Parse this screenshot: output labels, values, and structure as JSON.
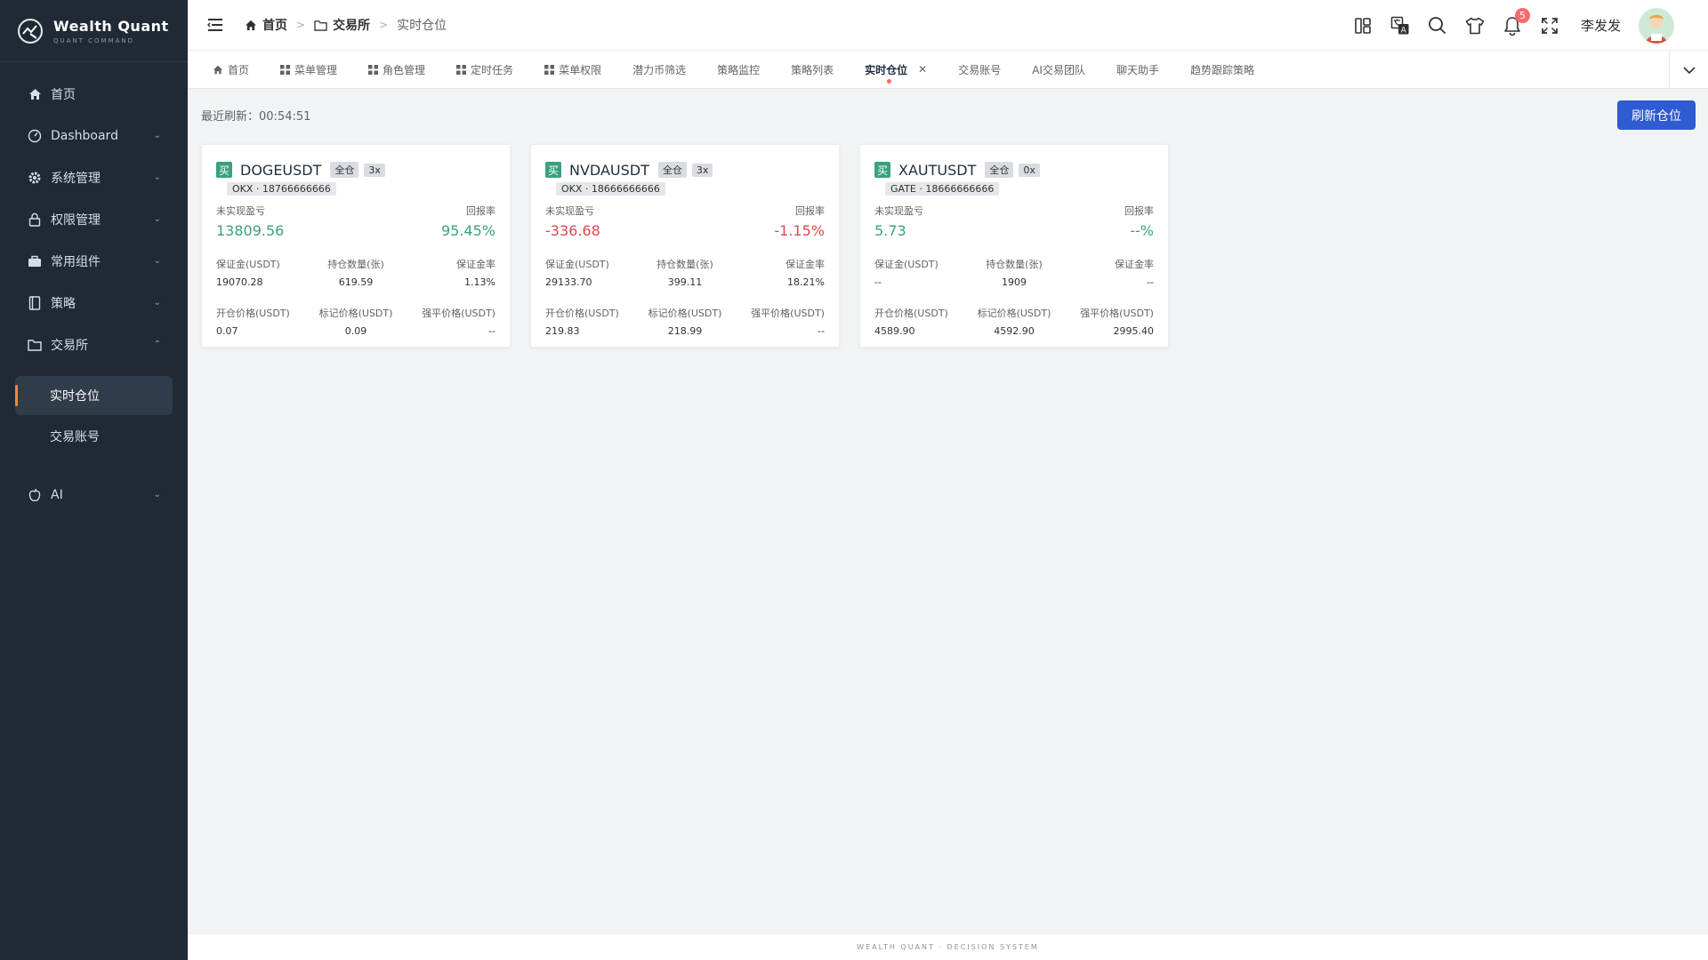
{
  "brand": {
    "name": "Wealth Quant",
    "subtitle": "QUANT COMMAND"
  },
  "sidebar": {
    "items": [
      {
        "label": "首页",
        "icon": "home-icon",
        "expandable": false
      },
      {
        "label": "Dashboard",
        "icon": "dashboard-icon",
        "expandable": true
      },
      {
        "label": "系统管理",
        "icon": "gear-icon",
        "expandable": true
      },
      {
        "label": "权限管理",
        "icon": "lock-icon",
        "expandable": true
      },
      {
        "label": "常用组件",
        "icon": "briefcase-icon",
        "expandable": true
      },
      {
        "label": "策略",
        "icon": "book-icon",
        "expandable": true
      },
      {
        "label": "交易所",
        "icon": "folder-icon",
        "expandable": true,
        "expanded": true
      },
      {
        "label": "AI",
        "icon": "apple-icon",
        "expandable": true
      }
    ],
    "submenu": [
      {
        "label": "实时仓位",
        "active": true
      },
      {
        "label": "交易账号",
        "active": false
      }
    ]
  },
  "header": {
    "breadcrumb": [
      "首页",
      "交易所",
      "实时仓位"
    ],
    "username": "李发发",
    "notification_count": "5"
  },
  "tabs": [
    {
      "label": "首页",
      "icon": "home-icon"
    },
    {
      "label": "菜单管理",
      "icon": "grid-icon"
    },
    {
      "label": "角色管理",
      "icon": "grid-icon"
    },
    {
      "label": "定时任务",
      "icon": "grid-icon"
    },
    {
      "label": "菜单权限",
      "icon": "grid-icon"
    },
    {
      "label": "潜力币筛选"
    },
    {
      "label": "策略监控"
    },
    {
      "label": "策略列表"
    },
    {
      "label": "实时仓位",
      "active": true,
      "closable": true
    },
    {
      "label": "交易账号"
    },
    {
      "label": "AI交易团队"
    },
    {
      "label": "聊天助手"
    },
    {
      "label": "趋势跟踪策略"
    }
  ],
  "main": {
    "last_refresh_label": "最近刷新：",
    "last_refresh_time": "00:54:51",
    "refresh_button": "刷新仓位"
  },
  "labels": {
    "buy": "买",
    "unrealized_pnl": "未实现盈亏",
    "return_rate": "回报率",
    "margin": "保证金(USDT)",
    "position_qty": "持仓数量(张)",
    "margin_rate": "保证金率",
    "entry_price": "开仓价格(USDT)",
    "mark_price": "标记价格(USDT)",
    "liq_price": "强平价格(USDT)"
  },
  "positions": [
    {
      "symbol": "DOGEUSDT",
      "mode": "全仓",
      "leverage": "3x",
      "account": "OKX · 18766666666",
      "pnl": "13809.56",
      "roe": "95.45%",
      "pnl_positive": true,
      "margin": "19070.28",
      "qty": "619.59",
      "margin_rate": "1.13%",
      "entry": "0.07",
      "mark": "0.09",
      "liq": "--"
    },
    {
      "symbol": "NVDAUSDT",
      "mode": "全仓",
      "leverage": "3x",
      "account": "OKX · 18666666666",
      "pnl": "-336.68",
      "roe": "-1.15%",
      "pnl_positive": false,
      "margin": "29133.70",
      "qty": "399.11",
      "margin_rate": "18.21%",
      "entry": "219.83",
      "mark": "218.99",
      "liq": "--"
    },
    {
      "symbol": "XAUTUSDT",
      "mode": "全仓",
      "leverage": "0x",
      "account": "GATE · 18666666666",
      "pnl": "5.73",
      "roe": "--%",
      "pnl_positive": true,
      "margin": "--",
      "qty": "1909",
      "margin_rate": "--",
      "entry": "4589.90",
      "mark": "4592.90",
      "liq": "2995.40"
    }
  ],
  "footer": {
    "text": "WEALTH QUANT · DECISION SYSTEM"
  },
  "colors": {
    "sidebar_bg": "#1f2a35",
    "accent": "#2f5bd3",
    "positive": "#3aa17e",
    "negative": "#e0454f",
    "active_marker": "#f08a3a"
  }
}
